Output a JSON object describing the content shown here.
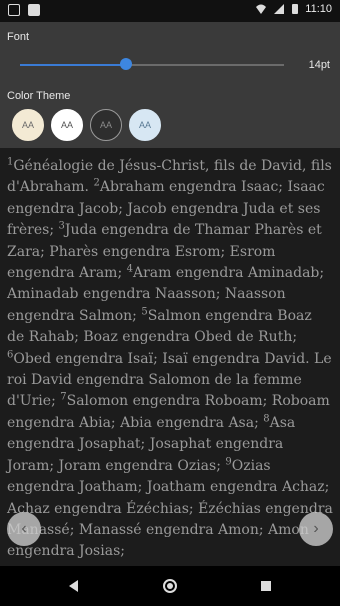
{
  "status": {
    "time": "11:10"
  },
  "font": {
    "label": "Font",
    "size_label": "14pt",
    "level": 0.4
  },
  "theme": {
    "label": "Color Theme",
    "options": [
      {
        "text": "AA",
        "bg": "#f3ead4",
        "fg": "#6b6b6b",
        "border": "#f3ead4"
      },
      {
        "text": "AA",
        "bg": "#ffffff",
        "fg": "#555555",
        "border": "#ffffff"
      },
      {
        "text": "AA",
        "bg": "#2e2e2e",
        "fg": "#8a8a8a",
        "border": "#9a9a9a"
      },
      {
        "text": "AA",
        "bg": "#d7e7f3",
        "fg": "#5a7a94",
        "border": "#d7e7f3"
      }
    ]
  },
  "verses": [
    {
      "n": "1",
      "t": "Généalogie de Jésus-Christ, fils de David, fils d'Abraham. "
    },
    {
      "n": "2",
      "t": "Abraham engendra Isaac; Isaac engendra Jacob; Jacob engendra Juda et ses frères; "
    },
    {
      "n": "3",
      "t": "Juda engendra de Thamar Pharès et Zara; Pharès engendra Esrom; Esrom engendra Aram; "
    },
    {
      "n": "4",
      "t": "Aram engendra Aminadab; Aminadab engendra Naasson; Naasson engendra Salmon; "
    },
    {
      "n": "5",
      "t": "Salmon engendra Boaz de Rahab; Boaz engendra Obed de Ruth; "
    },
    {
      "n": "6",
      "t": "Obed engendra Isaï; Isaï engendra David. Le roi David engendra Salomon de la femme d'Urie; "
    },
    {
      "n": "7",
      "t": "Salomon engendra Roboam; Roboam engendra Abia; Abia engendra Asa; "
    },
    {
      "n": "8",
      "t": "Asa engendra Josaphat; Josaphat engendra Joram; Joram engendra Ozias; "
    },
    {
      "n": "9",
      "t": "Ozias engendra Joatham; Joatham engendra Achaz; Achaz engendra Ézéchias; Ézéchias engendra Manassé; Manassé engendra Amon; Amon engendra Josias;"
    }
  ],
  "nav": {
    "prev": "‹",
    "next": "›"
  }
}
